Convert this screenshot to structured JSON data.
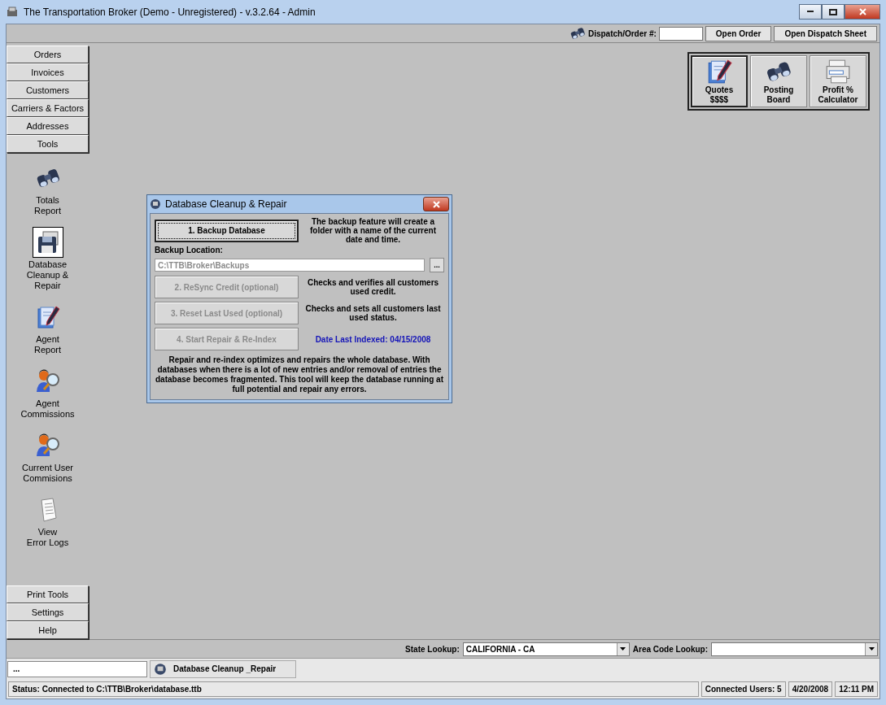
{
  "window": {
    "title": "The Transportation Broker (Demo - Unregistered) - v.3.2.64 - Admin"
  },
  "toolbar": {
    "dispatch_label": "Dispatch/Order #:",
    "buttons": [
      "Open Order",
      "Open Dispatch Sheet"
    ]
  },
  "nav_top": [
    "Orders",
    "Invoices",
    "Customers",
    "Carriers & Factors",
    "Addresses",
    "Tools"
  ],
  "tools": [
    {
      "label": "Totals\nReport",
      "kind": "binoculars",
      "selected": false
    },
    {
      "label": "Database\nCleanup &\nRepair",
      "kind": "disk",
      "selected": true
    },
    {
      "label": "Agent\nReport",
      "kind": "quote",
      "selected": false
    },
    {
      "label": "Agent\nCommissions",
      "kind": "agent",
      "selected": false
    },
    {
      "label": "Current User\nCommisions",
      "kind": "agent",
      "selected": false
    },
    {
      "label": "View\nError Logs",
      "kind": "document",
      "selected": false
    }
  ],
  "nav_bottom": [
    "Print Tools",
    "Settings",
    "Help"
  ],
  "quick_buttons": [
    {
      "label": "Quotes\n$$$$",
      "kind": "quote",
      "selected": true
    },
    {
      "label": "Posting\nBoard",
      "kind": "binoculars",
      "selected": false
    },
    {
      "label": "Profit %\nCalculator",
      "kind": "calculator",
      "selected": false
    }
  ],
  "dialog": {
    "title": "Database Cleanup & Repair",
    "steps": [
      {
        "label": "1. Backup Database",
        "enabled": true,
        "note": "The backup feature will create a folder with a name of the current date and time.",
        "kind": "plain"
      },
      {
        "label": "2. ReSync Credit (optional)",
        "enabled": false,
        "note": "Checks and verifies all customers used credit.",
        "kind": "plain"
      },
      {
        "label": "3. Reset Last Used (optional)",
        "enabled": false,
        "note": "Checks and sets all customers last used status.",
        "kind": "plain"
      },
      {
        "label": "4. Start Repair & Re-Index",
        "enabled": false,
        "note": "Date Last Indexed: 04/15/2008",
        "kind": "accent"
      }
    ],
    "backup_location_label": "Backup Location:",
    "backup_location_value": "C:\\TTB\\Broker\\Backups",
    "browse_button": "...",
    "description": "Repair and re-index optimizes and repairs the whole database. With databases when there is a lot of new entries and/or removal of entries the database becomes fragmented. This tool will keep the database running at full potential and repair any errors."
  },
  "lookups": [
    {
      "label": "State Lookup:",
      "value": "CALIFORNIA - CA"
    },
    {
      "label": "Area Code Lookup:"
    }
  ],
  "taskbar": {
    "left": "...",
    "tasks": [
      "Database Cleanup _Repair"
    ]
  },
  "status_bar": {
    "status": "Status: Connected to C:\\TTB\\Broker\\database.ttb",
    "users": "Connected Users: 5",
    "date": "4/20/2008",
    "time": "12:11 PM"
  }
}
